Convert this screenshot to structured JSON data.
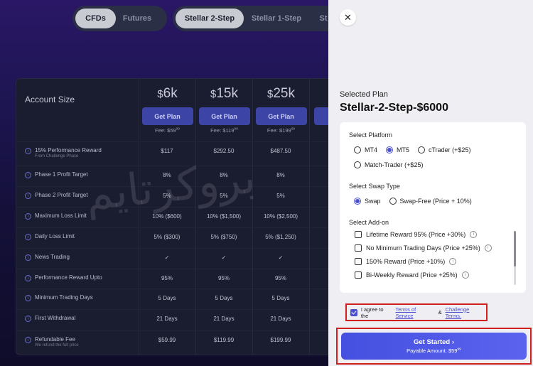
{
  "tabs_type": [
    {
      "label": "CFDs",
      "active": true
    },
    {
      "label": "Futures",
      "active": false
    }
  ],
  "tabs_plan": [
    {
      "label": "Stellar 2-Step",
      "active": true
    },
    {
      "label": "Stellar 1-Step",
      "active": false
    },
    {
      "label": "St",
      "active": false
    }
  ],
  "table": {
    "account_size_label": "Account Size",
    "get_plan_label": "Get Plan",
    "fee_prefix": "Fee:",
    "columns": [
      {
        "size": "6k",
        "fee": "$59",
        "fee_cents": "99"
      },
      {
        "size": "15k",
        "fee": "$119",
        "fee_cents": "99"
      },
      {
        "size": "25k",
        "fee": "$199",
        "fee_cents": "99"
      }
    ],
    "rows": [
      {
        "label": "15% Performance Reward",
        "sub": "From Challenge Phase",
        "values": [
          "$117",
          "$292.50",
          "$487.50"
        ]
      },
      {
        "label": "Phase 1 Profit Target",
        "sub": "",
        "values": [
          "8%",
          "8%",
          "8%"
        ]
      },
      {
        "label": "Phase 2 Profit Target",
        "sub": "",
        "values": [
          "5%",
          "5%",
          "5%"
        ]
      },
      {
        "label": "Maximum Loss Limit",
        "sub": "",
        "values": [
          "10% ($600)",
          "10% ($1,500)",
          "10% ($2,500)"
        ]
      },
      {
        "label": "Daily Loss Limit",
        "sub": "",
        "values": [
          "5% ($300)",
          "5% ($750)",
          "5% ($1,250)"
        ]
      },
      {
        "label": "News Trading",
        "sub": "",
        "values": [
          "✓",
          "✓",
          "✓"
        ]
      },
      {
        "label": "Performance Reward Upto",
        "sub": "",
        "values": [
          "95%",
          "95%",
          "95%"
        ]
      },
      {
        "label": "Minimum Trading Days",
        "sub": "",
        "values": [
          "5 Days",
          "5 Days",
          "5 Days"
        ]
      },
      {
        "label": "First Withdrawal",
        "sub": "",
        "values": [
          "21 Days",
          "21 Days",
          "21 Days"
        ]
      },
      {
        "label": "Refundable Fee",
        "sub": "We refund the full price",
        "values": [
          "$59.99",
          "$119.99",
          "$199.99"
        ]
      }
    ]
  },
  "watermark": "بروکرتایم",
  "panel": {
    "selected_label": "Selected Plan",
    "selected_value": "Stellar-2-Step-$6000",
    "platform_title": "Select Platform",
    "platforms": [
      {
        "label": "MT4",
        "selected": false
      },
      {
        "label": "MT5",
        "selected": true
      },
      {
        "label": "cTrader (+$25)",
        "selected": false
      },
      {
        "label": "Match-Trader (+$25)",
        "selected": false
      }
    ],
    "swap_title": "Select Swap Type",
    "swaps": [
      {
        "label": "Swap",
        "selected": true
      },
      {
        "label": "Swap-Free (Price + 10%)",
        "selected": false
      }
    ],
    "addon_title": "Select Add-on",
    "addons": [
      {
        "label": "Lifetime Reward 95% (Price +30%)"
      },
      {
        "label": "No Minimum Trading Days (Price +25%)"
      },
      {
        "label": "150% Reward (Price +10%)"
      },
      {
        "label": "Bi-Weekly Reward (Price +25%)"
      }
    ],
    "agree_text": "I agree to the",
    "terms_link": "Terms of Service",
    "amp": "&",
    "challenge_link": "Challenge Terms.",
    "cta_label": "Get Started",
    "cta_amount_label": "Payable Amount:",
    "cta_amount": "$59",
    "cta_amount_cents": "99"
  },
  "colors": {
    "accent": "#4a4fd0",
    "highlight": "#d0201d"
  }
}
